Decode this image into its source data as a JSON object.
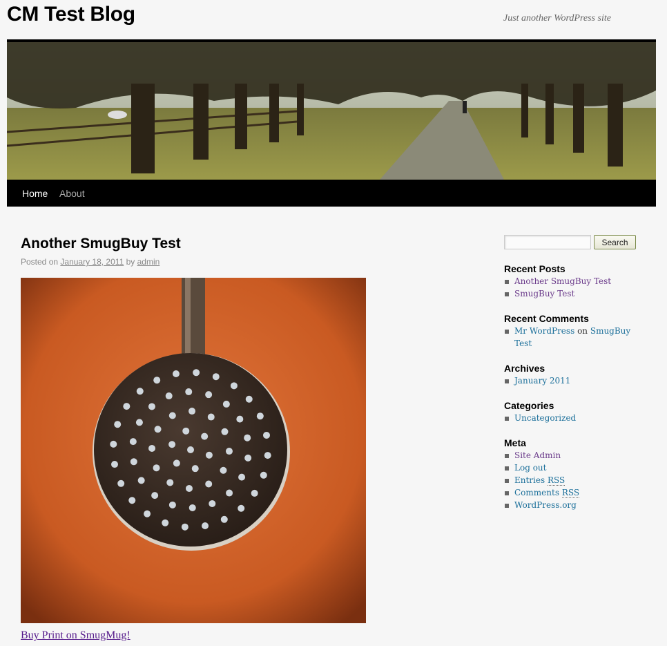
{
  "site": {
    "title": "CM Test Blog",
    "description": "Just another WordPress site"
  },
  "nav": {
    "items": [
      {
        "label": "Home"
      },
      {
        "label": "About"
      }
    ]
  },
  "post": {
    "title": "Another SmugBuy Test",
    "meta_prefix": "Posted on",
    "date": "January 18, 2011",
    "meta_by": "by",
    "author": "admin",
    "buy_link": "Buy Print on SmugMug!"
  },
  "sidebar": {
    "search_button": "Search",
    "recent_posts": {
      "title": "Recent Posts",
      "items": [
        "Another SmugBuy Test",
        "SmugBuy Test"
      ]
    },
    "recent_comments": {
      "title": "Recent Comments",
      "author": "Mr WordPress",
      "on": "on",
      "post_line1": "SmugBuy",
      "post_line2": "Test"
    },
    "archives": {
      "title": "Archives",
      "items": [
        "January 2011"
      ]
    },
    "categories": {
      "title": "Categories",
      "items": [
        "Uncategorized"
      ]
    },
    "meta": {
      "title": "Meta",
      "site_admin": "Site Admin",
      "log_out": "Log out",
      "entries": "Entries",
      "comments": "Comments",
      "rss": "RSS",
      "wordpress": "WordPress.org"
    }
  },
  "colors": {
    "link": "#1b6f9a",
    "visited": "#6a3a8a",
    "nav_bg": "#000000",
    "page_bg": "#f6f6f6"
  }
}
